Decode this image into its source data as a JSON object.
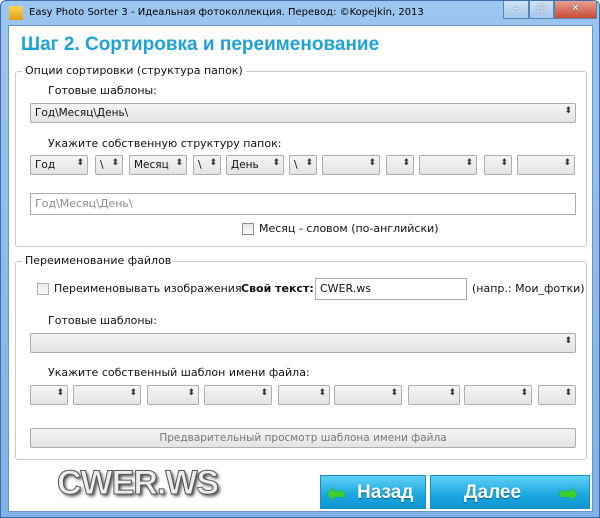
{
  "window": {
    "title": "Easy Photo Sorter 3 - Идеальная фотоколлекция. Перевод: ©Kopejkin, 2013",
    "minimize": "–",
    "maximize": "□",
    "close": "✕"
  },
  "header": {
    "title": "Шаг 2. Сортировка и переименование"
  },
  "sorting": {
    "legend": "Опции сортировки (структура папок)",
    "templates_label": "Готовые шаблоны:",
    "template_value": "Год\\Месяц\\День\\",
    "custom_label": "Укажите собственную структуру папок:",
    "parts": [
      "Год",
      "\\",
      "Месяц",
      "\\",
      "День",
      "\\",
      "",
      "",
      "",
      "",
      ""
    ],
    "preview_placeholder": "Год\\Месяц\\День\\",
    "month_word_label": "Месяц - словом (по-английски)",
    "month_word_checked": false
  },
  "renaming": {
    "legend": "Переименование файлов",
    "rename_label": "Переименовывать изображения",
    "rename_checked": false,
    "own_text_label": "Свой текст:",
    "own_text_value": "CWER.ws",
    "example": "(напр.: Мои_фотки)",
    "templates_label": "Готовые шаблоны:",
    "template_value": "",
    "custom_label": "Укажите собственный шаблон имени файла:",
    "parts": [
      "",
      "",
      "",
      "",
      "",
      "",
      "",
      "",
      ""
    ],
    "preview_button": "Предварительный просмотр шаблона имени файла"
  },
  "footer": {
    "logo": "CWER.WS",
    "back": "Назад",
    "next": "Далее"
  },
  "colors": {
    "title": "#1ea2d8",
    "button": "#1aa8e0",
    "arrow": "#3fcf2a"
  }
}
